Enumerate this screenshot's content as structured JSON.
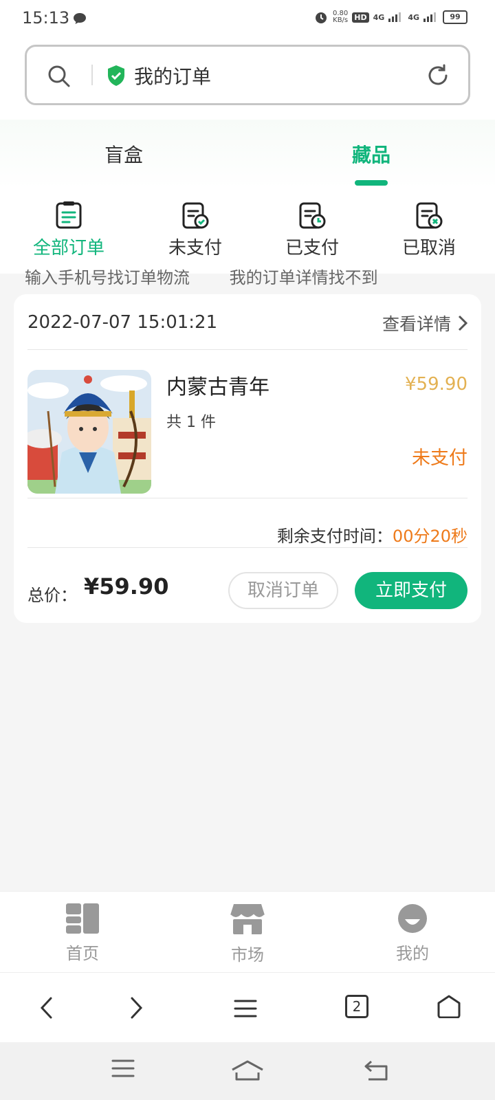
{
  "status_bar": {
    "time": "15:13",
    "net_speed": "0.80",
    "net_unit": "KB/s",
    "hd": "HD",
    "signal1": "4G",
    "signal2": "4G",
    "battery": "99"
  },
  "browser": {
    "page_title": "我的订单"
  },
  "top_tabs": [
    {
      "label": "盲盒",
      "active": false
    },
    {
      "label": "藏品",
      "active": true
    }
  ],
  "filters": [
    {
      "label": "全部订单",
      "active": true,
      "icon": "all-orders-icon"
    },
    {
      "label": "未支付",
      "active": false,
      "icon": "unpaid-icon"
    },
    {
      "label": "已支付",
      "active": false,
      "icon": "paid-icon"
    },
    {
      "label": "已取消",
      "active": false,
      "icon": "cancelled-icon"
    }
  ],
  "ghost_suggestions": [
    "输入手机号找订单物流",
    "我的订单详情找不到"
  ],
  "order": {
    "datetime": "2022-07-07 15:01:21",
    "detail_link": "查看详情",
    "product_name": "内蒙古青年",
    "count_text": "共 1 件",
    "price": "¥59.90",
    "status": "未支付",
    "remain_label": "剩余支付时间：",
    "remain_value": "00分20秒",
    "total_label": "总价：",
    "total_value": "¥59.90",
    "cancel_label": "取消订单",
    "pay_label": "立即支付"
  },
  "app_nav": [
    {
      "label": "首页",
      "icon": "home-grid-icon"
    },
    {
      "label": "市场",
      "icon": "market-store-icon"
    },
    {
      "label": "我的",
      "icon": "profile-icon"
    }
  ],
  "browser_toolbar": {
    "tab_count": "2"
  },
  "colors": {
    "accent": "#11b57c",
    "price": "#e3b152",
    "warning": "#ee7a1a"
  }
}
